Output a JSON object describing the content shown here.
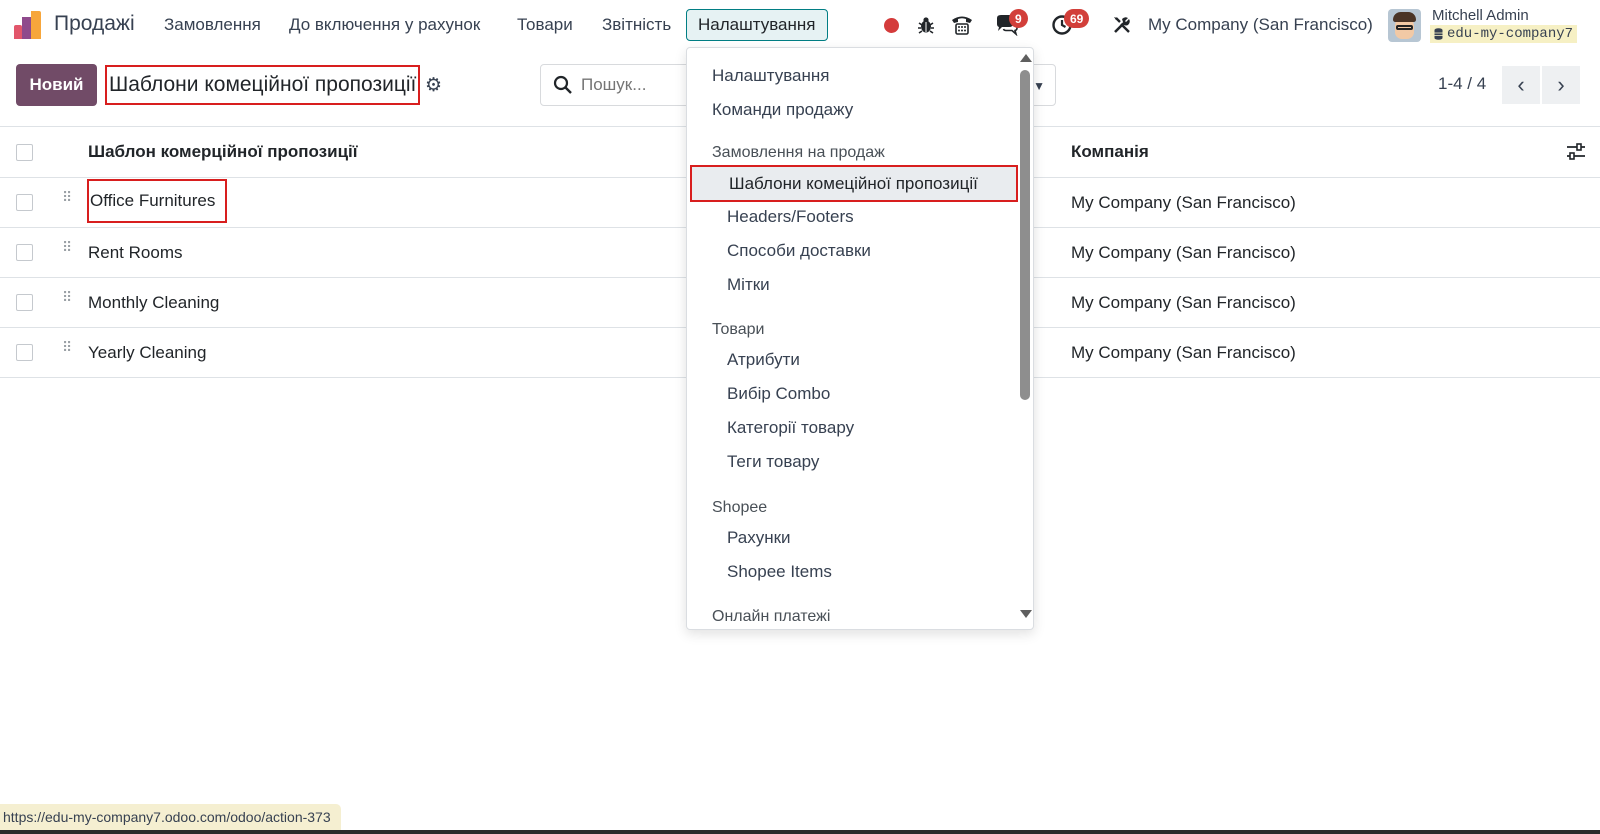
{
  "app": {
    "name": "Продажі"
  },
  "menu": {
    "items": [
      "Замовлення",
      "До включення у рахунок",
      "Товари",
      "Звітність",
      "Налаштування"
    ]
  },
  "systray": {
    "chat_badge": "9",
    "activity_badge": "69",
    "company": "My Company (San Francisco)",
    "user_name": "Mitchell Admin",
    "database": "edu-my-company7"
  },
  "control": {
    "new_button": "Новий",
    "title": "Шаблони комеційної пропозиції",
    "search_placeholder": "Пошук...",
    "pager": "1-4 / 4"
  },
  "list": {
    "columns": [
      "Шаблон комерційної пропозиції",
      "Компанія"
    ],
    "rows": [
      {
        "name": "Office Furnitures",
        "company": "My Company (San Francisco)"
      },
      {
        "name": "Rent Rooms",
        "company": "My Company (San Francisco)"
      },
      {
        "name": "Monthly Cleaning",
        "company": "My Company (San Francisco)"
      },
      {
        "name": "Yearly Cleaning",
        "company": "My Company (San Francisco)"
      }
    ]
  },
  "dropdown": {
    "top_items": [
      "Налаштування",
      "Команди продажу"
    ],
    "sections": [
      {
        "title": "Замовлення на продаж",
        "items": [
          "Шаблони комеційної пропозиції",
          "Headers/Footers",
          "Способи доставки",
          "Мітки"
        ]
      },
      {
        "title": "Товари",
        "items": [
          "Атрибути",
          "Вибір Combo",
          "Категорії товару",
          "Теги товару"
        ]
      },
      {
        "title": "Shopee",
        "items": [
          "Рахунки",
          "Shopee Items"
        ]
      },
      {
        "title": "Онлайн платежі",
        "items": []
      }
    ],
    "highlighted_item": "Шаблони комеційної пропозиції"
  },
  "status_bar": {
    "url": "https://edu-my-company7.odoo.com/odoo/action-373"
  },
  "colors": {
    "brand": "#714b67",
    "active_menu": "#017e84",
    "annotation": "#d81e1e",
    "badge": "#d23f3a"
  }
}
